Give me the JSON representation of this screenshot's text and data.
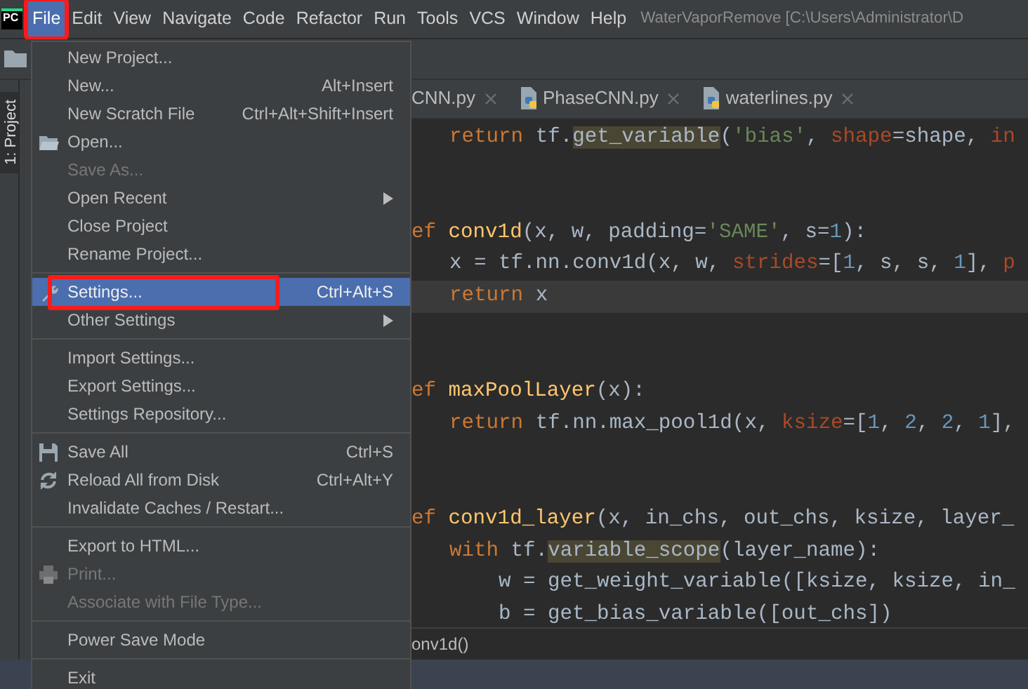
{
  "menubar": {
    "logo": "PC",
    "items": [
      {
        "label": "File",
        "selected": true,
        "annotated": true
      },
      {
        "label": "Edit",
        "selected": false,
        "annotated": false
      },
      {
        "label": "View",
        "selected": false,
        "annotated": false
      },
      {
        "label": "Navigate",
        "selected": false,
        "annotated": false
      },
      {
        "label": "Code",
        "selected": false,
        "annotated": false
      },
      {
        "label": "Refactor",
        "selected": false,
        "annotated": false
      },
      {
        "label": "Run",
        "selected": false,
        "annotated": false
      },
      {
        "label": "Tools",
        "selected": false,
        "annotated": false
      },
      {
        "label": "VCS",
        "selected": false,
        "annotated": false
      },
      {
        "label": "Window",
        "selected": false,
        "annotated": false
      },
      {
        "label": "Help",
        "selected": false,
        "annotated": false
      }
    ],
    "title": "WaterVaporRemove [C:\\Users\\Administrator\\D"
  },
  "side_tab": {
    "label": "1: Project"
  },
  "editor_tabs": [
    {
      "label": "CNN.py",
      "icon": false
    },
    {
      "label": "PhaseCNN.py",
      "icon": true
    },
    {
      "label": "waterlines.py",
      "icon": true
    }
  ],
  "code_lines": [
    {
      "kind": "block",
      "current": false,
      "tokens": [
        {
          "kind": "kw",
          "s": "return "
        },
        {
          "kind": "p",
          "s": "tf."
        },
        {
          "kind": "hl",
          "s": "get_variable"
        },
        {
          "kind": "p",
          "s": "("
        },
        {
          "kind": "str",
          "s": "'bias'"
        },
        {
          "kind": "p",
          "s": ", "
        },
        {
          "kind": "arg",
          "s": "shape"
        },
        {
          "kind": "p",
          "s": "=shape, "
        },
        {
          "kind": "arg",
          "s": "in"
        }
      ]
    },
    {
      "kind": "blank",
      "current": false
    },
    {
      "kind": "blank",
      "current": false
    },
    {
      "kind": "top",
      "current": false,
      "tokens": [
        {
          "kind": "kw",
          "s": "ef "
        },
        {
          "kind": "fn",
          "s": "conv1d"
        },
        {
          "kind": "p",
          "s": "(x, w, padding="
        },
        {
          "kind": "str",
          "s": "'SAME'"
        },
        {
          "kind": "p",
          "s": ", s="
        },
        {
          "kind": "num",
          "s": "1"
        },
        {
          "kind": "p",
          "s": "):"
        }
      ]
    },
    {
      "kind": "block",
      "current": false,
      "tokens": [
        {
          "kind": "p",
          "s": "x = tf.nn.conv1d(x, w, "
        },
        {
          "kind": "arg",
          "s": "strides"
        },
        {
          "kind": "p",
          "s": "=["
        },
        {
          "kind": "num",
          "s": "1"
        },
        {
          "kind": "p",
          "s": ", s, s, "
        },
        {
          "kind": "num",
          "s": "1"
        },
        {
          "kind": "p",
          "s": "], "
        },
        {
          "kind": "arg",
          "s": "p"
        }
      ]
    },
    {
      "kind": "block",
      "current": true,
      "tokens": [
        {
          "kind": "kw",
          "s": "return "
        },
        {
          "kind": "p",
          "s": "x"
        }
      ]
    },
    {
      "kind": "blank",
      "current": false
    },
    {
      "kind": "blank",
      "current": false
    },
    {
      "kind": "top",
      "current": false,
      "tokens": [
        {
          "kind": "kw",
          "s": "ef "
        },
        {
          "kind": "fn",
          "s": "maxPoolLayer"
        },
        {
          "kind": "p",
          "s": "(x):"
        }
      ]
    },
    {
      "kind": "block",
      "current": false,
      "tokens": [
        {
          "kind": "kw",
          "s": "return "
        },
        {
          "kind": "p",
          "s": "tf.nn.max_pool1d(x, "
        },
        {
          "kind": "arg",
          "s": "ksize"
        },
        {
          "kind": "p",
          "s": "=["
        },
        {
          "kind": "num",
          "s": "1"
        },
        {
          "kind": "p",
          "s": ", "
        },
        {
          "kind": "num",
          "s": "2"
        },
        {
          "kind": "p",
          "s": ", "
        },
        {
          "kind": "num",
          "s": "2"
        },
        {
          "kind": "p",
          "s": ", "
        },
        {
          "kind": "num",
          "s": "1"
        },
        {
          "kind": "p",
          "s": "],"
        }
      ]
    },
    {
      "kind": "blank",
      "current": false
    },
    {
      "kind": "blank",
      "current": false
    },
    {
      "kind": "top",
      "current": false,
      "tokens": [
        {
          "kind": "kw",
          "s": "ef "
        },
        {
          "kind": "fn",
          "s": "conv1d_layer"
        },
        {
          "kind": "p",
          "s": "(x, in_chs, out_chs, ksize, layer_"
        }
      ]
    },
    {
      "kind": "block",
      "current": false,
      "tokens": [
        {
          "kind": "kw",
          "s": "with "
        },
        {
          "kind": "p",
          "s": "tf."
        },
        {
          "kind": "hl",
          "s": "variable_scope"
        },
        {
          "kind": "p",
          "s": "(layer_name):"
        }
      ]
    },
    {
      "kind": "inner",
      "current": false,
      "tokens": [
        {
          "kind": "p",
          "s": "w = get_weight_variable([ksize, ksize, in_"
        }
      ]
    },
    {
      "kind": "inner",
      "current": false,
      "tokens": [
        {
          "kind": "p",
          "s": "b = get_bias_variable([out_chs])"
        }
      ]
    }
  ],
  "breadcrumb": "onv1d()",
  "file_menu": [
    {
      "kind": "item",
      "label": "New Project...",
      "disabled": false,
      "selected": false,
      "submenu": false,
      "annotated": false
    },
    {
      "kind": "item",
      "label": "New...",
      "shortcut": "Alt+Insert",
      "disabled": false,
      "selected": false,
      "submenu": false,
      "annotated": false
    },
    {
      "kind": "item",
      "label": "New Scratch File",
      "shortcut": "Ctrl+Alt+Shift+Insert",
      "disabled": false,
      "selected": false,
      "submenu": false,
      "annotated": false
    },
    {
      "kind": "item",
      "label": "Open...",
      "disabled": false,
      "selected": false,
      "submenu": false,
      "annotated": false
    },
    {
      "kind": "item",
      "label": "Save As...",
      "disabled": true,
      "selected": false,
      "submenu": false,
      "annotated": false
    },
    {
      "kind": "item",
      "label": "Open Recent",
      "disabled": false,
      "selected": false,
      "submenu": true,
      "annotated": false
    },
    {
      "kind": "item",
      "label": "Close Project",
      "disabled": false,
      "selected": false,
      "submenu": false,
      "annotated": false
    },
    {
      "kind": "item",
      "label": "Rename Project...",
      "disabled": false,
      "selected": false,
      "submenu": false,
      "annotated": false
    },
    {
      "kind": "separator"
    },
    {
      "kind": "item",
      "label": "Settings...",
      "shortcut": "Ctrl+Alt+S",
      "disabled": false,
      "selected": true,
      "submenu": false,
      "annotated": true
    },
    {
      "kind": "item",
      "label": "Other Settings",
      "disabled": false,
      "selected": false,
      "submenu": true,
      "annotated": false
    },
    {
      "kind": "separator"
    },
    {
      "kind": "item",
      "label": "Import Settings...",
      "disabled": false,
      "selected": false,
      "submenu": false,
      "annotated": false
    },
    {
      "kind": "item",
      "label": "Export Settings...",
      "disabled": false,
      "selected": false,
      "submenu": false,
      "annotated": false
    },
    {
      "kind": "item",
      "label": "Settings Repository...",
      "disabled": false,
      "selected": false,
      "submenu": false,
      "annotated": false
    },
    {
      "kind": "separator"
    },
    {
      "kind": "item",
      "label": "Save All",
      "shortcut": "Ctrl+S",
      "disabled": false,
      "selected": false,
      "submenu": false,
      "annotated": false
    },
    {
      "kind": "item",
      "label": "Reload All from Disk",
      "shortcut": "Ctrl+Alt+Y",
      "disabled": false,
      "selected": false,
      "submenu": false,
      "annotated": false
    },
    {
      "kind": "item",
      "label": "Invalidate Caches / Restart...",
      "disabled": false,
      "selected": false,
      "submenu": false,
      "annotated": false
    },
    {
      "kind": "separator"
    },
    {
      "kind": "item",
      "label": "Export to HTML...",
      "disabled": false,
      "selected": false,
      "submenu": false,
      "annotated": false
    },
    {
      "kind": "item",
      "label": "Print...",
      "disabled": true,
      "selected": false,
      "submenu": false,
      "annotated": false
    },
    {
      "kind": "item",
      "label": "Associate with File Type...",
      "disabled": true,
      "selected": false,
      "submenu": false,
      "annotated": false
    },
    {
      "kind": "separator"
    },
    {
      "kind": "item",
      "label": "Power Save Mode",
      "disabled": false,
      "selected": false,
      "submenu": false,
      "annotated": false
    },
    {
      "kind": "separator"
    },
    {
      "kind": "item",
      "label": "Exit",
      "disabled": false,
      "selected": false,
      "submenu": false,
      "annotated": false
    }
  ]
}
